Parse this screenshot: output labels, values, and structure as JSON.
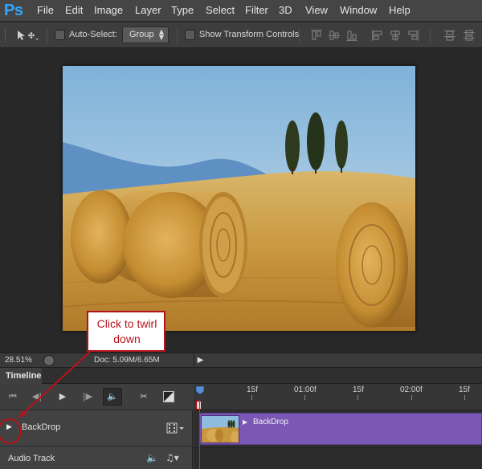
{
  "app": {
    "logo": "Ps",
    "brand_color": "#31a8ff",
    "menu": [
      "File",
      "Edit",
      "Image",
      "Layer",
      "Type",
      "Select",
      "Filter",
      "3D",
      "View",
      "Window",
      "Help"
    ]
  },
  "options_bar": {
    "auto_select_label": "Auto-Select:",
    "auto_select_checked": false,
    "auto_select_target": "Group",
    "show_transform_label": "Show Transform Controls",
    "show_transform_checked": false,
    "tool_icon": "move-tool-icon",
    "align_icons": [
      "align-top-edges-icon",
      "align-vertical-centers-icon",
      "align-bottom-edges-icon",
      "align-left-edges-icon",
      "align-horizontal-centers-icon",
      "align-right-edges-icon",
      "distribute-top-icon",
      "distribute-vertical-centers-icon"
    ]
  },
  "status_bar": {
    "zoom": "28.51%",
    "doc_info": "Doc: 5.09M/6.65M"
  },
  "timeline": {
    "tab_label": "Timeline",
    "controls": [
      "go-to-first-frame-icon",
      "previous-frame-icon",
      "play-icon",
      "next-frame-icon",
      "audio-icon",
      "split-at-playhead-icon",
      "transition-icon"
    ],
    "ruler_ticks": [
      "15f",
      "01:00f",
      "15f",
      "02:00f",
      "15f"
    ],
    "tracks": [
      {
        "name": "BackDrop",
        "clip_label": "BackDrop",
        "clip_color": "#7b58b5"
      },
      {
        "name": "Audio Track"
      }
    ]
  },
  "callout": {
    "text": "Click to twirl down",
    "color": "#b7121b"
  }
}
